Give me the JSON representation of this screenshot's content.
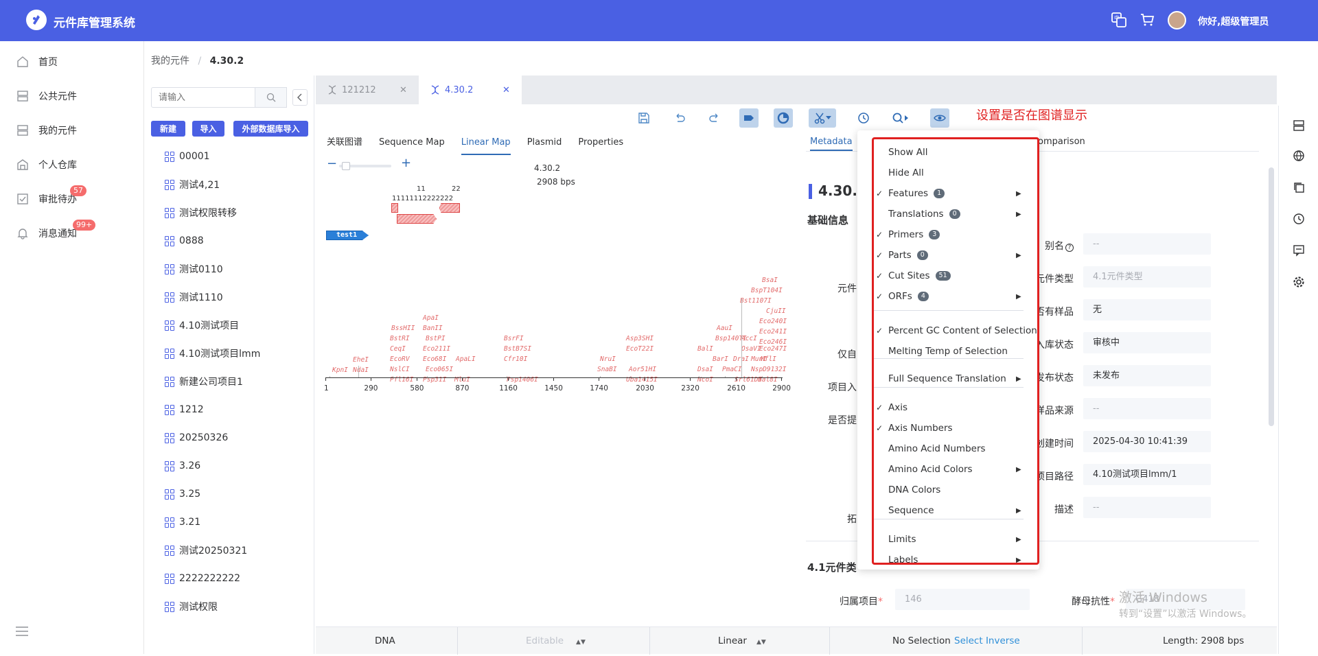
{
  "app": {
    "title": "元件库管理系统",
    "greeting": "你好,超级管理员"
  },
  "topbar_icons": [
    "translate-icon",
    "cart-icon"
  ],
  "sidebar": {
    "items": [
      {
        "label": "首页",
        "icon": "home-icon"
      },
      {
        "label": "公共元件",
        "icon": "server-icon"
      },
      {
        "label": "我的元件",
        "icon": "server-icon"
      },
      {
        "label": "个人仓库",
        "icon": "warehouse-icon"
      },
      {
        "label": "审批待办",
        "icon": "approve-icon",
        "badge": "57"
      },
      {
        "label": "消息通知",
        "icon": "bell-icon",
        "badge": "99+"
      }
    ]
  },
  "breadcrumb": {
    "root": "我的元件",
    "sep": "/",
    "current": "4.30.2"
  },
  "tree": {
    "search_placeholder": "请输入",
    "buttons": {
      "new": "新建",
      "import": "导入",
      "external_import": "外部数据库导入"
    },
    "items": [
      "00001",
      "测试4,21",
      "测试权限转移",
      "0888",
      "测试0110",
      "测试1110",
      "4.10测试项目",
      "4.10测试项目lmm",
      "新建公司项目1",
      "1212",
      "20250326",
      "3.26",
      "3.25",
      "3.21",
      "测试20250321",
      "2222222222",
      "测试权限"
    ]
  },
  "tabs": [
    {
      "label": "121212",
      "active": false
    },
    {
      "label": "4.30.2",
      "active": true
    }
  ],
  "annotation": "设置是否在图谱显示",
  "subtabs": [
    "关联图谱",
    "Sequence Map",
    "Linear Map",
    "Plasmid",
    "Properties"
  ],
  "active_subtab": "Linear Map",
  "map": {
    "name": "4.30.2",
    "length": "2908 bps",
    "part_label": "test1",
    "primer_labels": [
      "11",
      "22",
      "11111112222222"
    ],
    "axis_ticks": [
      "1",
      "290",
      "580",
      "870",
      "1160",
      "1450",
      "1740",
      "2030",
      "2320",
      "2610",
      "2900"
    ],
    "enzymes": [
      {
        "name": "KpnI",
        "pos": 0
      },
      {
        "name": "EheI",
        "pos": 1
      },
      {
        "name": "NdaI",
        "pos": 2
      },
      {
        "name": "BssHII",
        "pos": 3
      },
      {
        "name": "BstRI",
        "pos": 4
      },
      {
        "name": "CeqI",
        "pos": 5
      },
      {
        "name": "EcoRV",
        "pos": 6
      },
      {
        "name": "NslCI",
        "pos": 7
      },
      {
        "name": "Pfl16I",
        "pos": 8
      },
      {
        "name": "ApaI",
        "pos": 9
      },
      {
        "name": "BanII",
        "pos": 10
      },
      {
        "name": "BstPI",
        "pos": 11
      },
      {
        "name": "Eco211I",
        "pos": 12
      },
      {
        "name": "Eco68I",
        "pos": 13
      },
      {
        "name": "Eco065I",
        "pos": 14
      },
      {
        "name": "Psp31I",
        "pos": 15
      },
      {
        "name": "ApaLI",
        "pos": 16
      },
      {
        "name": "MluI",
        "pos": 17
      },
      {
        "name": "BsrFI",
        "pos": 18
      },
      {
        "name": "BstB7SI",
        "pos": 19
      },
      {
        "name": "Cfr10I",
        "pos": 20
      },
      {
        "name": "Psp1406I",
        "pos": 21
      },
      {
        "name": "NruI",
        "pos": 22
      },
      {
        "name": "SnaBI",
        "pos": 23
      },
      {
        "name": "Asp3SHI",
        "pos": 24
      },
      {
        "name": "EcoT22I",
        "pos": 25
      },
      {
        "name": "Aor51HI",
        "pos": 26
      },
      {
        "name": "Uba1415I",
        "pos": 27
      },
      {
        "name": "BalI",
        "pos": 28
      },
      {
        "name": "DsaI",
        "pos": 29
      },
      {
        "name": "NcoI",
        "pos": 30
      },
      {
        "name": "AauI",
        "pos": 31
      },
      {
        "name": "Bsp140TI",
        "pos": 32
      },
      {
        "name": "BarI",
        "pos": 33
      },
      {
        "name": "PmaCI",
        "pos": 34
      },
      {
        "name": "DraI",
        "pos": 35
      },
      {
        "name": "AccI",
        "pos": 36
      },
      {
        "name": "OsaVI",
        "pos": 37
      },
      {
        "name": "Srl61DI",
        "pos": 38
      },
      {
        "name": "BsaI",
        "pos": 39
      },
      {
        "name": "BspT104I",
        "pos": 40
      },
      {
        "name": "Bst1107I",
        "pos": 41
      },
      {
        "name": "CjuII",
        "pos": 42
      },
      {
        "name": "Eco240I",
        "pos": 43
      },
      {
        "name": "Eco241I",
        "pos": 44
      },
      {
        "name": "Eco246I",
        "pos": 45
      },
      {
        "name": "Eco247I",
        "pos": 46
      },
      {
        "name": "MunI",
        "pos": 47
      },
      {
        "name": "MflI",
        "pos": 48
      },
      {
        "name": "NspD9132I",
        "pos": 49
      },
      {
        "name": "Hal8I",
        "pos": 50
      }
    ]
  },
  "right_panel": {
    "tabs": [
      "Metadata",
      "omparison"
    ],
    "title": "4.30.2",
    "section1": "基础信息",
    "section2": "4.1元件类",
    "fields_right": [
      {
        "label": "别名",
        "value": "--",
        "muted": true
      },
      {
        "label": "元件类型",
        "value": "4.1元件类型",
        "muted": true
      },
      {
        "label": "是否有样品",
        "value": "无",
        "muted": false
      },
      {
        "label": "公共入库状态",
        "value": "审核中",
        "muted": false
      },
      {
        "label": "发布状态",
        "value": "未发布",
        "muted": false
      },
      {
        "label": "样品来源",
        "value": "--",
        "muted": true
      },
      {
        "label": "创建时间",
        "value": "2025-04-30 10:41:39",
        "muted": false
      },
      {
        "label": "项目路径",
        "value": "4.10测试项目lmm/1",
        "muted": false
      },
      {
        "label": "描述",
        "value": "--",
        "muted": true
      }
    ],
    "fields_left_partial": [
      "元件",
      "仅自",
      "项目入",
      "是否提",
      "拓"
    ],
    "bottom_fields": [
      {
        "label": "归属项目",
        "value": "146",
        "required": true
      },
      {
        "label": "酵母抗性",
        "value": "G418",
        "required": true
      }
    ]
  },
  "menu": {
    "items": [
      {
        "label": "Show All",
        "checked": false,
        "count": null,
        "submenu": false,
        "group": 0
      },
      {
        "label": "Hide All",
        "checked": false,
        "count": null,
        "submenu": false,
        "group": 0
      },
      {
        "label": "Features",
        "checked": true,
        "count": "1",
        "submenu": true,
        "group": 0
      },
      {
        "label": "Translations",
        "checked": false,
        "count": "0",
        "submenu": true,
        "group": 0
      },
      {
        "label": "Primers",
        "checked": true,
        "count": "3",
        "submenu": false,
        "group": 0
      },
      {
        "label": "Parts",
        "checked": true,
        "count": "0",
        "submenu": true,
        "group": 0
      },
      {
        "label": "Cut Sites",
        "checked": true,
        "count": "51",
        "submenu": false,
        "group": 0
      },
      {
        "label": "ORFs",
        "checked": true,
        "count": "4",
        "submenu": true,
        "group": 0
      },
      {
        "label": "Percent GC Content of Selection",
        "checked": true,
        "count": null,
        "submenu": false,
        "group": 1
      },
      {
        "label": "Melting Temp of Selection",
        "checked": false,
        "count": null,
        "submenu": false,
        "group": 1
      },
      {
        "label": "Full Sequence Translation",
        "checked": false,
        "count": null,
        "submenu": true,
        "group": 2
      },
      {
        "label": "Axis",
        "checked": true,
        "count": null,
        "submenu": false,
        "group": 3
      },
      {
        "label": "Axis Numbers",
        "checked": true,
        "count": null,
        "submenu": false,
        "group": 3
      },
      {
        "label": "Amino Acid Numbers",
        "checked": false,
        "count": null,
        "submenu": false,
        "group": 3
      },
      {
        "label": "Amino Acid Colors",
        "checked": false,
        "count": null,
        "submenu": true,
        "group": 3
      },
      {
        "label": "DNA Colors",
        "checked": false,
        "count": null,
        "submenu": false,
        "group": 3
      },
      {
        "label": "Sequence",
        "checked": false,
        "count": null,
        "submenu": true,
        "group": 3
      },
      {
        "label": "Limits",
        "checked": false,
        "count": null,
        "submenu": true,
        "group": 4
      },
      {
        "label": "Labels",
        "checked": false,
        "count": null,
        "submenu": true,
        "group": 4
      }
    ]
  },
  "statusbar": {
    "type": "DNA",
    "editable": "Editable",
    "topology": "Linear",
    "selection": "No Selection",
    "select_inverse": "Select Inverse",
    "length": "Length: 2908 bps"
  },
  "watermark": {
    "line1": "激活 Windows",
    "line2": "转到“设置”以激活 Windows。"
  },
  "colors": {
    "primary": "#4a60e3",
    "annotation": "#e02020",
    "badge": "#f56c6c",
    "linkblue": "#2f6bb5"
  }
}
